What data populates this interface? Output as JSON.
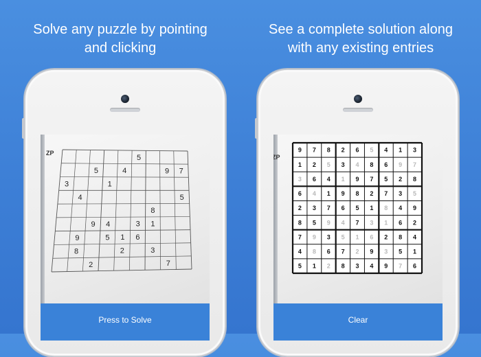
{
  "captions": {
    "left": [
      "Solve any puzzle by pointing",
      "and clicking"
    ],
    "right": [
      "See a complete solution along",
      "with any existing entries"
    ]
  },
  "left_phone": {
    "page_mark": "ZP",
    "button_label": "Press to Solve",
    "puzzle": [
      [
        "",
        "",
        "",
        "",
        "",
        "5",
        "",
        "",
        ""
      ],
      [
        "",
        "",
        "5",
        "",
        "4",
        "",
        "",
        "9",
        "7"
      ],
      [
        "3",
        "",
        "",
        "1",
        "",
        "",
        "",
        "",
        ""
      ],
      [
        "",
        "4",
        "",
        "",
        "",
        "",
        "",
        "",
        "5"
      ],
      [
        "",
        "",
        "",
        "",
        "",
        "",
        "8",
        "",
        ""
      ],
      [
        "",
        "",
        "9",
        "4",
        "",
        "3",
        "1",
        "",
        ""
      ],
      [
        "",
        "9",
        "",
        "5",
        "1",
        "6",
        "",
        "",
        ""
      ],
      [
        "",
        "8",
        "",
        "",
        "2",
        "",
        "3",
        "",
        ""
      ],
      [
        "",
        "",
        "2",
        "",
        "",
        "",
        "",
        "7",
        ""
      ]
    ]
  },
  "right_phone": {
    "page_mark": "ZP",
    "button_label": "Clear",
    "solution": [
      [
        "9",
        "7",
        "8",
        "2",
        "6",
        "5",
        "4",
        "1",
        "3"
      ],
      [
        "1",
        "2",
        "5",
        "3",
        "4",
        "8",
        "6",
        "9",
        "7"
      ],
      [
        "3",
        "6",
        "4",
        "1",
        "9",
        "7",
        "5",
        "2",
        "8"
      ],
      [
        "6",
        "4",
        "1",
        "9",
        "8",
        "2",
        "7",
        "3",
        "5"
      ],
      [
        "2",
        "3",
        "7",
        "6",
        "5",
        "1",
        "8",
        "4",
        "9"
      ],
      [
        "8",
        "5",
        "9",
        "4",
        "7",
        "3",
        "1",
        "6",
        "2"
      ],
      [
        "7",
        "9",
        "3",
        "5",
        "1",
        "6",
        "2",
        "8",
        "4"
      ],
      [
        "4",
        "8",
        "6",
        "7",
        "2",
        "9",
        "3",
        "5",
        "1"
      ],
      [
        "5",
        "1",
        "2",
        "8",
        "3",
        "4",
        "9",
        "7",
        "6"
      ]
    ],
    "given": [
      [
        0,
        0,
        0,
        0,
        0,
        1,
        0,
        0,
        0
      ],
      [
        0,
        0,
        1,
        0,
        1,
        0,
        0,
        1,
        1
      ],
      [
        1,
        0,
        0,
        1,
        0,
        0,
        0,
        0,
        0
      ],
      [
        0,
        1,
        0,
        0,
        0,
        0,
        0,
        0,
        1
      ],
      [
        0,
        0,
        0,
        0,
        0,
        0,
        1,
        0,
        0
      ],
      [
        0,
        0,
        1,
        1,
        0,
        1,
        1,
        0,
        0
      ],
      [
        0,
        1,
        0,
        1,
        1,
        1,
        0,
        0,
        0
      ],
      [
        0,
        1,
        0,
        0,
        1,
        0,
        1,
        0,
        0
      ],
      [
        0,
        0,
        1,
        0,
        0,
        0,
        0,
        1,
        0
      ]
    ]
  },
  "colors": {
    "background": "#3d7fd6",
    "button": "#3a82d8",
    "given_digit": "#b8b8b8",
    "solved_digit": "#111111"
  }
}
